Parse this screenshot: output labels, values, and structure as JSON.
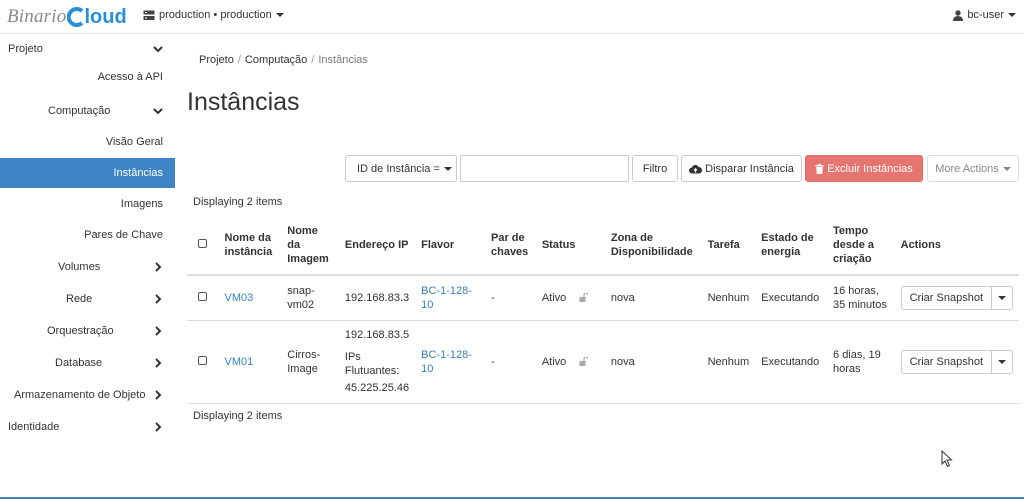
{
  "topbar": {
    "logo_text_1": "Binario",
    "logo_text_2": "loud",
    "project": "production • production",
    "user": "bc-user"
  },
  "sidebar": {
    "items": [
      {
        "label": "Projeto",
        "chevron": "down"
      },
      {
        "label": "Acesso à API"
      },
      {
        "label": "Computação",
        "chevron": "down"
      },
      {
        "label": "Visão Geral"
      },
      {
        "label": "Instâncias",
        "active": true
      },
      {
        "label": "Imagens"
      },
      {
        "label": "Pares de Chave"
      },
      {
        "label": "Volumes",
        "chevron": "right"
      },
      {
        "label": "Rede",
        "chevron": "right"
      },
      {
        "label": "Orquestração",
        "chevron": "right"
      },
      {
        "label": "Database",
        "chevron": "right"
      },
      {
        "label": "Armazenamento de Objeto",
        "chevron": "right"
      },
      {
        "label": "Identidade",
        "chevron": "right"
      }
    ]
  },
  "breadcrumb": [
    "Projeto",
    "Computação",
    "Instâncias"
  ],
  "page_title": "Instâncias",
  "toolbar": {
    "filter_select": "ID de Instância =",
    "filter_input_value": "",
    "filter_button": "Filtro",
    "launch_button": "Disparar Instância",
    "delete_button": "Excluir Instâncias",
    "more_actions": "More Actions"
  },
  "displaying_text": "Displaying 2 items",
  "table": {
    "headers": {
      "name": "Nome da instância",
      "image": "Nome da Imagem",
      "ip": "Endereço IP",
      "flavor": "Flavor",
      "keypair": "Par de chaves",
      "status": "Status",
      "zone": "Zona de Disponibilidade",
      "task": "Tarefa",
      "power": "Estado de energia",
      "age": "Tempo desde a criação",
      "actions": "Actions"
    },
    "rows": [
      {
        "name": "VM03",
        "image": "snap-vm02",
        "ip": "192.168.83.3",
        "ip_floating_label": "",
        "ip_floating": "",
        "flavor": "BC-1-128-10",
        "keypair": "-",
        "status": "Ativo",
        "zone": "nova",
        "task": "Nenhum",
        "power": "Executando",
        "age": "16 horas, 35 minutos",
        "action": "Criar Snapshot"
      },
      {
        "name": "VM01",
        "image": "Cirros-Image",
        "ip": "192.168.83.5",
        "ip_floating_label": "IPs Flutuantes:",
        "ip_floating": "45.225.25.46",
        "flavor": "BC-1-128-10",
        "keypair": "-",
        "status": "Ativo",
        "zone": "nova",
        "task": "Nenhum",
        "power": "Executando",
        "age": "6 dias, 19 horas",
        "action": "Criar Snapshot"
      }
    ]
  },
  "colors": {
    "accent": "#3f85c6",
    "link": "#3a7fc1",
    "danger": "#e67571",
    "logo_cloud": "#2a8fd4"
  }
}
